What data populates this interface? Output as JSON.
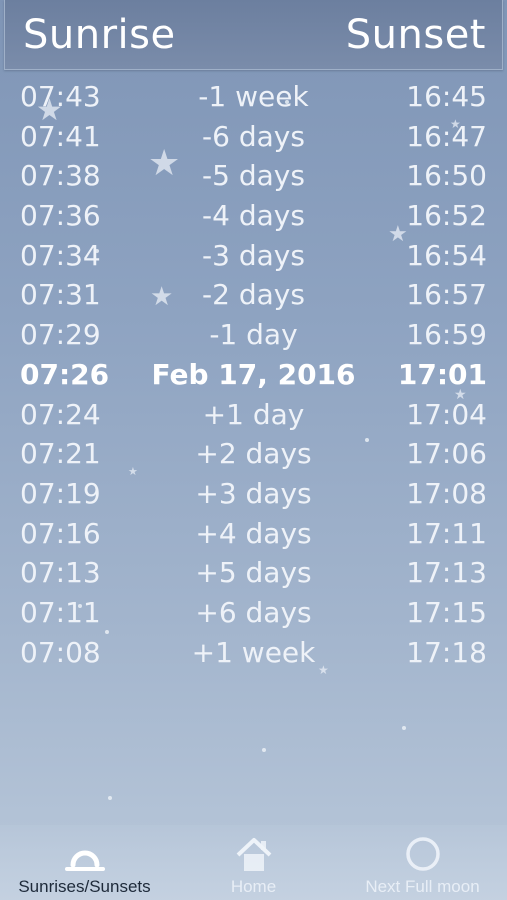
{
  "header": {
    "sunrise_title": "Sunrise",
    "sunset_title": "Sunset"
  },
  "rows": [
    {
      "sunrise": "07:43",
      "label": "-1 week",
      "sunset": "16:45"
    },
    {
      "sunrise": "07:41",
      "label": "-6 days",
      "sunset": "16:47"
    },
    {
      "sunrise": "07:38",
      "label": "-5 days",
      "sunset": "16:50"
    },
    {
      "sunrise": "07:36",
      "label": "-4 days",
      "sunset": "16:52"
    },
    {
      "sunrise": "07:34",
      "label": "-3 days",
      "sunset": "16:54"
    },
    {
      "sunrise": "07:31",
      "label": "-2 days",
      "sunset": "16:57"
    },
    {
      "sunrise": "07:29",
      "label": "-1 day",
      "sunset": "16:59"
    },
    {
      "sunrise": "07:26",
      "label": "Feb 17, 2016",
      "sunset": "17:01"
    },
    {
      "sunrise": "07:24",
      "label": "+1 day",
      "sunset": "17:04"
    },
    {
      "sunrise": "07:21",
      "label": "+2 days",
      "sunset": "17:06"
    },
    {
      "sunrise": "07:19",
      "label": "+3 days",
      "sunset": "17:08"
    },
    {
      "sunrise": "07:16",
      "label": "+4 days",
      "sunset": "17:11"
    },
    {
      "sunrise": "07:13",
      "label": "+5 days",
      "sunset": "17:13"
    },
    {
      "sunrise": "07:11",
      "label": "+6 days",
      "sunset": "17:15"
    },
    {
      "sunrise": "07:08",
      "label": "+1 week",
      "sunset": "17:18"
    }
  ],
  "tabs": [
    {
      "label": "Sunrises/Sunsets",
      "icon": "sunrise-sunset-icon",
      "active": true
    },
    {
      "label": "Home",
      "icon": "home-icon",
      "active": false
    },
    {
      "label": "Next Full moon",
      "icon": "full-moon-icon",
      "active": false
    }
  ],
  "colors": {
    "background_top": "#7f95b6",
    "background_bottom": "#b9c8da",
    "header": "#6c7f9f",
    "active_tab": "#1e2a3a",
    "inactive_tab": "#e8eef6"
  }
}
